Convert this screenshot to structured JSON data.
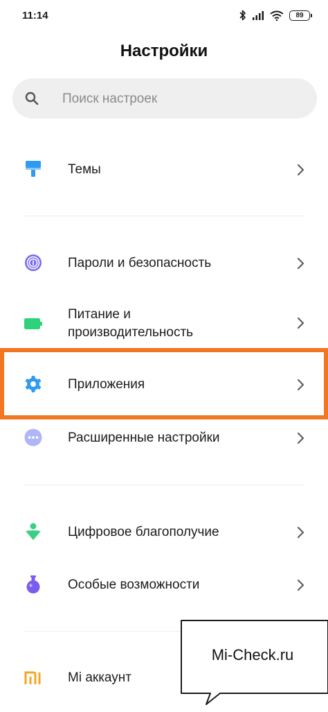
{
  "status_bar": {
    "time": "11:14",
    "battery": "89"
  },
  "title": "Настройки",
  "search": {
    "placeholder": "Поиск настроек"
  },
  "items": [
    {
      "label": "Темы",
      "icon": "paint-brush-icon",
      "color": "#2f9bf0"
    },
    {
      "label": "Пароли и безопасность",
      "icon": "fingerprint-icon",
      "color": "#7d6cf0"
    },
    {
      "label": "Питание и производительность",
      "label_line1": "Питание и",
      "label_line2": "производительность",
      "icon": "battery-icon",
      "color": "#2fd27a"
    },
    {
      "label": "Приложения",
      "icon": "gear-icon",
      "color": "#2f9bf0"
    },
    {
      "label": "Расширенные настройки",
      "icon": "more-dots-icon",
      "color": "#b0b6f5"
    },
    {
      "label": "Цифровое благополучие",
      "icon": "wellbeing-icon",
      "color": "#3ccf84"
    },
    {
      "label": "Особые возможности",
      "icon": "flask-icon",
      "color": "#7a5cf0"
    },
    {
      "label": "Mi аккаунт",
      "icon": "mi-logo-icon",
      "color": "#f5a623"
    }
  ],
  "watermark": "Mi-Check.ru",
  "colors": {
    "highlight": "#f37623",
    "chevron": "#5e5e5e"
  }
}
